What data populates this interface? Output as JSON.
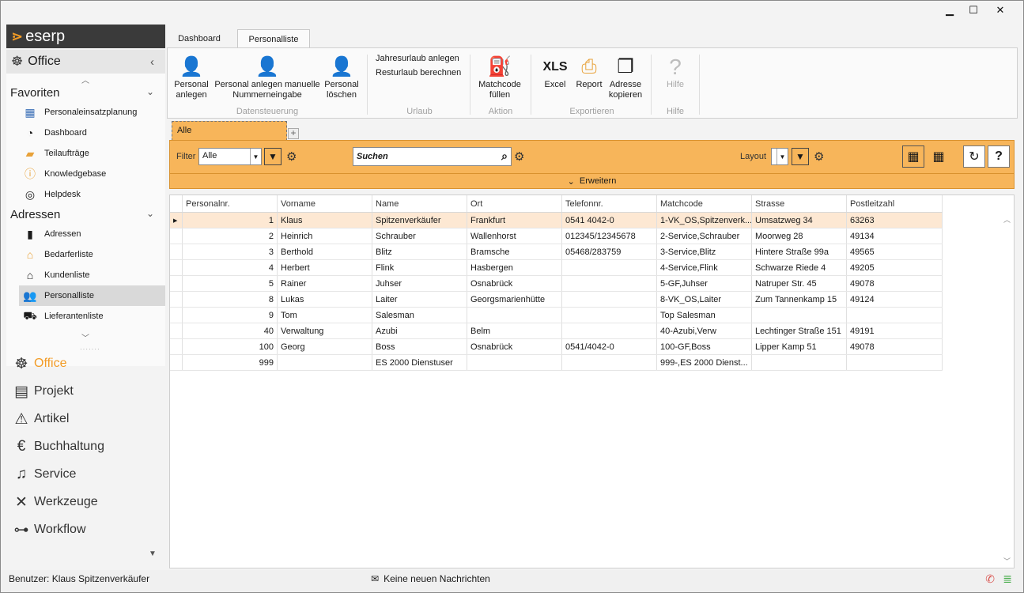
{
  "window": {
    "minimize": "▁",
    "maximize": "☐",
    "close": "✕"
  },
  "logo": "eserp",
  "sidebar": {
    "office_head": "Office",
    "favoriten": {
      "title": "Favoriten",
      "items": [
        "Personaleinsatzplanung",
        "Dashboard",
        "Teilaufträge",
        "Knowledgebase",
        "Helpdesk"
      ]
    },
    "adressen": {
      "title": "Adressen",
      "items": [
        "Adressen",
        "Bedarferliste",
        "Kundenliste",
        "Personalliste",
        "Lieferantenliste"
      ]
    },
    "modules": [
      "Office",
      "Projekt",
      "Artikel",
      "Buchhaltung",
      "Service",
      "Werkzeuge",
      "Workflow"
    ]
  },
  "ribbon": {
    "tabs": [
      "Dashboard",
      "Personalliste"
    ],
    "buttons": {
      "personal_anlegen": [
        "Personal",
        "anlegen"
      ],
      "personal_manuell": [
        "Personal anlegen manuelle",
        "Nummerneingabe"
      ],
      "personal_loeschen": [
        "Personal",
        "löschen"
      ],
      "jahresurlaub": "Jahresurlaub anlegen",
      "resturlaub": "Resturlaub berechnen",
      "matchcode": [
        "Matchcode",
        "füllen"
      ],
      "excel_icon": "XLS",
      "excel": "Excel",
      "report": "Report",
      "adresse_kopieren": [
        "Adresse",
        "kopieren"
      ],
      "hilfe": "Hilfe"
    },
    "groups": [
      "Datensteuerung",
      "Urlaub",
      "Aktion",
      "Exportieren",
      "Hilfe"
    ]
  },
  "filter_tab": "Alle",
  "toolbar": {
    "filter_label": "Filter",
    "filter_value": "Alle",
    "search": "Suchen",
    "layout_label": "Layout",
    "expand": "Erweitern"
  },
  "grid": {
    "columns": [
      "Personalnr.",
      "Vorname",
      "Name",
      "Ort",
      "Telefonnr.",
      "Matchcode",
      "Strasse",
      "Postleitzahl"
    ],
    "rows": [
      [
        "1",
        "Klaus",
        "Spitzenverkäufer",
        "Frankfurt",
        "0541 4042-0",
        "1-VK_OS,Spitzenverk...",
        "Umsatzweg 34",
        "63263"
      ],
      [
        "2",
        "Heinrich",
        "Schrauber",
        "Wallenhorst",
        "012345/12345678",
        "2-Service,Schrauber",
        "Moorweg 28",
        "49134"
      ],
      [
        "3",
        "Berthold",
        "Blitz",
        "Bramsche",
        "05468/283759",
        "3-Service,Blitz",
        "Hintere Straße 99a",
        "49565"
      ],
      [
        "4",
        "Herbert",
        "Flink",
        "Hasbergen",
        "",
        "4-Service,Flink",
        "Schwarze Riede 4",
        "49205"
      ],
      [
        "5",
        "Rainer",
        "Juhser",
        "Osnabrück",
        "",
        "5-GF,Juhser",
        "Natruper Str. 45",
        "49078"
      ],
      [
        "8",
        "Lukas",
        "Laiter",
        "Georgsmarienhütte",
        "",
        "8-VK_OS,Laiter",
        "Zum Tannenkamp 15",
        "49124"
      ],
      [
        "9",
        "Tom",
        "Salesman",
        "",
        "",
        "Top Salesman",
        "",
        ""
      ],
      [
        "40",
        "Verwaltung",
        "Azubi",
        "Belm",
        "",
        "40-Azubi,Verw",
        "Lechtinger Straße 151",
        "49191"
      ],
      [
        "100",
        "Georg",
        "Boss",
        "Osnabrück",
        "0541/4042-0",
        "100-GF,Boss",
        "Lipper Kamp 51",
        "49078"
      ],
      [
        "999",
        "",
        "ES 2000 Dienstuser",
        "",
        "",
        "999-,ES 2000 Dienst...",
        "",
        ""
      ]
    ]
  },
  "status": {
    "user": "Benutzer: Klaus Spitzenverkäufer",
    "messages": "Keine neuen Nachrichten"
  }
}
